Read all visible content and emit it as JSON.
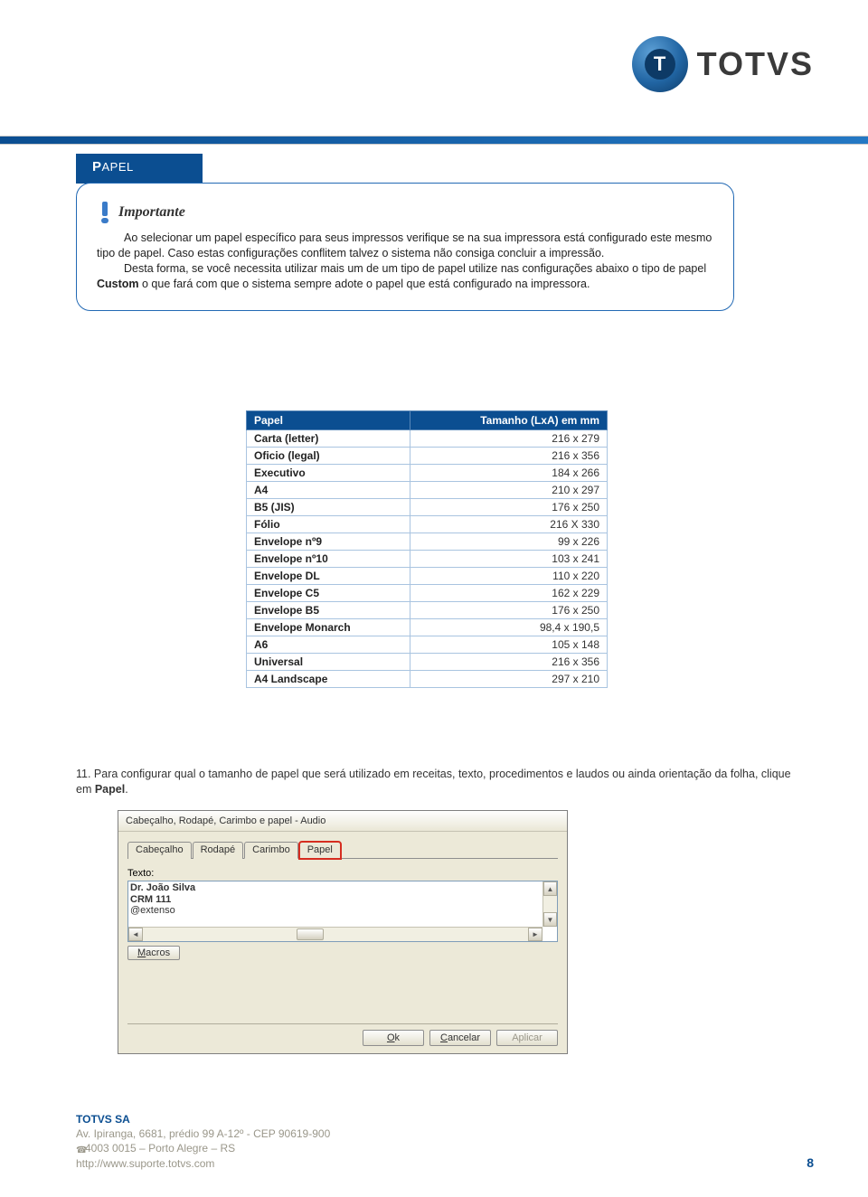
{
  "brand": {
    "name": "TOTVS",
    "t": "T"
  },
  "section_tab": {
    "label": "APEL",
    "cap": "P"
  },
  "callout": {
    "title": "Importante",
    "p1_a": "Ao selecionar um papel específico para seus impressos verifique se na sua impressora está configurado este mesmo tipo de papel. Caso estas configurações conflitem talvez o sistema não consiga concluir a impressão.",
    "p2_a": "Desta forma, se você necessita utilizar mais um de um tipo de papel utilize nas configurações abaixo o tipo de papel ",
    "p2_b": "Custom",
    "p2_c": " o que fará com que o sistema sempre adote o papel que está configurado na impressora."
  },
  "paper_table": {
    "h1": "Papel",
    "h2": "Tamanho (LxA) em mm",
    "rows": [
      {
        "name": "Carta (letter)",
        "size": "216 x 279"
      },
      {
        "name": "Oficio (legal)",
        "size": "216 x 356"
      },
      {
        "name": "Executivo",
        "size": "184 x 266"
      },
      {
        "name": "A4",
        "size": "210 x 297"
      },
      {
        "name": "B5 (JIS)",
        "size": "176 x 250"
      },
      {
        "name": "Fólio",
        "size": "216 X 330"
      },
      {
        "name": "Envelope nº9",
        "size": "99 x 226"
      },
      {
        "name": "Envelope nº10",
        "size": "103 x 241"
      },
      {
        "name": "Envelope DL",
        "size": "110 x 220"
      },
      {
        "name": "Envelope C5",
        "size": "162 x 229"
      },
      {
        "name": "Envelope B5",
        "size": "176 x 250"
      },
      {
        "name": "Envelope Monarch",
        "size": "98,4 x 190,5"
      },
      {
        "name": "A6",
        "size": "105 x 148"
      },
      {
        "name": "Universal",
        "size": "216 x 356"
      },
      {
        "name": "A4 Landscape",
        "size": "297 x 210"
      }
    ]
  },
  "step11": {
    "text_a": "11. Para configurar qual o tamanho de papel que será utilizado em receitas, texto, procedimentos e laudos ou ainda orientação da folha, clique em ",
    "text_bold": "Papel",
    "text_b": "."
  },
  "dialog": {
    "title": "Cabeçalho, Rodapé, Carimbo e papel - Audio",
    "tabs": {
      "t1": "Cabeçalho",
      "t2": "Rodapé",
      "t3": "Carimbo",
      "t4": "Papel"
    },
    "label": "Texto:",
    "text_lines": {
      "l1": "Dr. João Silva",
      "l2": "CRM 111",
      "l3": "@extenso"
    },
    "macros": "Macros",
    "ok": "Ok",
    "cancel": "Cancelar",
    "apply": "Aplicar"
  },
  "footer": {
    "company": "TOTVS SA",
    "addr": "Av. Ipiranga, 6681, prédio 99 A-12º - CEP 90619-900",
    "phone": "4003 0015 – Porto Alegre – RS",
    "url": "http://www.suporte.totvs.com"
  },
  "page_number": "8"
}
